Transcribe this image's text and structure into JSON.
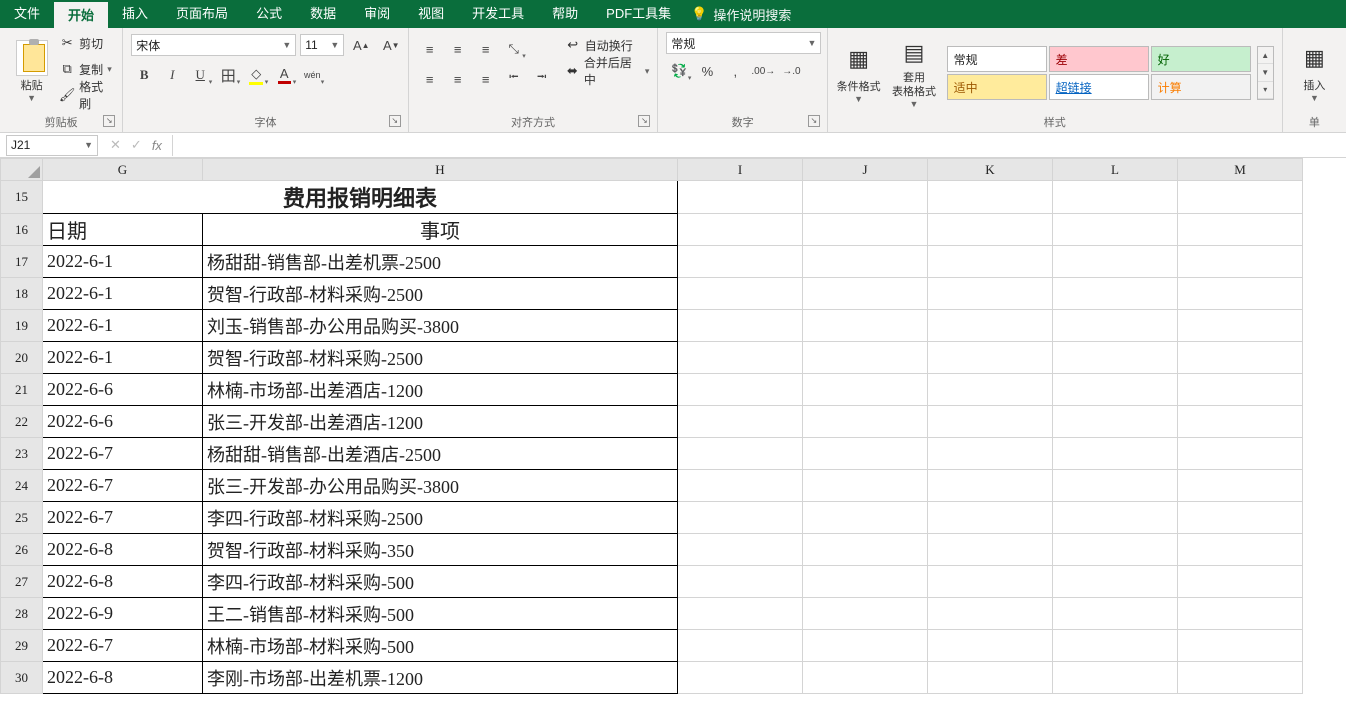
{
  "menu": {
    "tabs": [
      "文件",
      "开始",
      "插入",
      "页面布局",
      "公式",
      "数据",
      "审阅",
      "视图",
      "开发工具",
      "帮助",
      "PDF工具集"
    ],
    "active": 1,
    "search": "操作说明搜索"
  },
  "ribbon": {
    "clipboard": {
      "paste": "粘贴",
      "cut": "剪切",
      "copy": "复制",
      "painter": "格式刷",
      "label": "剪贴板"
    },
    "font": {
      "name": "宋体",
      "size": "11",
      "label": "字体"
    },
    "align": {
      "wrap": "自动换行",
      "merge": "合并后居中",
      "label": "对齐方式"
    },
    "number": {
      "fmt": "常规",
      "label": "数字"
    },
    "styles": {
      "cond": "条件格式",
      "tbl": "套用\n表格格式",
      "s1": "常规",
      "s2": "差",
      "s3": "好",
      "s4": "适中",
      "s5": "超链接",
      "s6": "计算",
      "label": "样式"
    },
    "cells": {
      "insert": "插入",
      "label": "单"
    }
  },
  "namebox": "J21",
  "cols": [
    "G",
    "H",
    "I",
    "J",
    "K",
    "L",
    "M"
  ],
  "rows": [
    {
      "n": 15,
      "type": "title",
      "g": "",
      "h": "费用报销明细表"
    },
    {
      "n": 16,
      "type": "hdr",
      "g": "日期",
      "h": "事项"
    },
    {
      "n": 17,
      "g": "2022-6-1",
      "h": "杨甜甜-销售部-出差机票-2500"
    },
    {
      "n": 18,
      "g": "2022-6-1",
      "h": "贺智-行政部-材料采购-2500"
    },
    {
      "n": 19,
      "g": "2022-6-1",
      "h": "刘玉-销售部-办公用品购买-3800"
    },
    {
      "n": 20,
      "g": "2022-6-1",
      "h": "贺智-行政部-材料采购-2500"
    },
    {
      "n": 21,
      "g": "2022-6-6",
      "h": "林楠-市场部-出差酒店-1200"
    },
    {
      "n": 22,
      "g": "2022-6-6",
      "h": "张三-开发部-出差酒店-1200"
    },
    {
      "n": 23,
      "g": "2022-6-7",
      "h": "杨甜甜-销售部-出差酒店-2500"
    },
    {
      "n": 24,
      "g": "2022-6-7",
      "h": "张三-开发部-办公用品购买-3800"
    },
    {
      "n": 25,
      "g": "2022-6-7",
      "h": "李四-行政部-材料采购-2500"
    },
    {
      "n": 26,
      "g": "2022-6-8",
      "h": "贺智-行政部-材料采购-350"
    },
    {
      "n": 27,
      "g": "2022-6-8",
      "h": "李四-行政部-材料采购-500"
    },
    {
      "n": 28,
      "g": "2022-6-9",
      "h": "王二-销售部-材料采购-500"
    },
    {
      "n": 29,
      "g": "2022-6-7",
      "h": "林楠-市场部-材料采购-500"
    },
    {
      "n": 30,
      "g": "2022-6-8",
      "h": "李刚-市场部-出差机票-1200"
    }
  ]
}
